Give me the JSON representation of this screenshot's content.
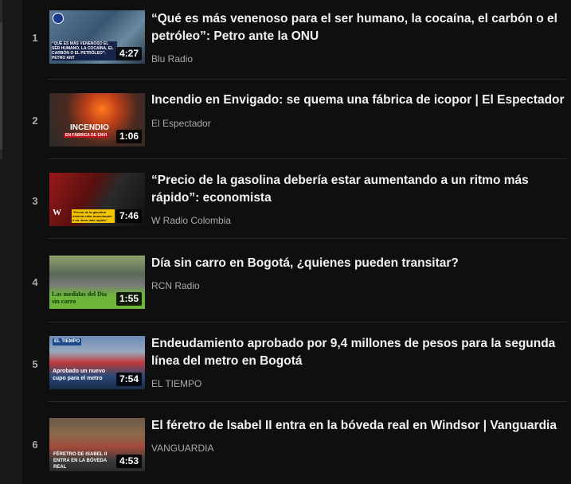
{
  "videos": [
    {
      "rank": "1",
      "title": "“Qué es más venenoso para el ser humano, la cocaína, el carbón o el petróleo”: Petro ante la ONU",
      "channel": "Blu Radio",
      "duration": "4:27",
      "thumb_caption": "“QUÉ ES MÁS VENENOSO EL SER HUMANO, LA COCAÍNA, EL CARBÓN O EL PETRÓLEO”: PETRO ANT",
      "thumb_color": "#4a6a8a"
    },
    {
      "rank": "2",
      "title": "Incendio en Envigado: se quema una fábrica de icopor | El Espectador",
      "channel": "El Espectador",
      "duration": "1:06",
      "thumb_caption": "INCENDIO",
      "thumb_subcaption": "EN FÁBRICA DE ENVI",
      "thumb_color": "#6b3a22"
    },
    {
      "rank": "3",
      "title": "“Precio de la gasolina debería estar aumentando a un ritmo más rápido”: economista",
      "channel": "W Radio Colombia",
      "duration": "7:46",
      "thumb_caption": "“Precio de la gasolina debería estar aumentando a un ritmo más rápido”",
      "thumb_logo": "W",
      "thumb_color": "#7a1f1f"
    },
    {
      "rank": "4",
      "title": "Día sin carro en Bogotá, ¿quienes pueden transitar?",
      "channel": "RCN Radio",
      "duration": "1:55",
      "thumb_caption": "Las medidas del Día sin carro",
      "thumb_color": "#6fb53a"
    },
    {
      "rank": "5",
      "title": "Endeudamiento aprobado por 9,4 millones de pesos para la segunda línea del metro en Bogotá",
      "channel": "EL TIEMPO",
      "duration": "7:54",
      "thumb_caption": "Aprobado un nuevo cupo para el metro",
      "thumb_logo": "EL TIEMPO",
      "thumb_color": "#3a5f9a"
    },
    {
      "rank": "6",
      "title": "El féretro de Isabel II entra en la bóveda real en Windsor | Vanguardia",
      "channel": "VANGUARDIA",
      "duration": "4:53",
      "thumb_caption": "FÉRETRO DE ISABEL II ENTRA EN LA BÓVEDA REAL",
      "thumb_color": "#7a5a3a"
    }
  ]
}
